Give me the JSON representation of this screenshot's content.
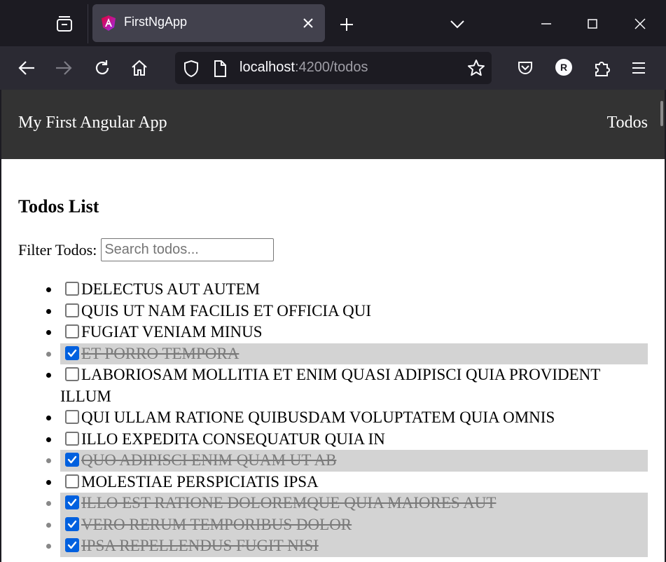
{
  "browser": {
    "tab_title": "FirstNgApp",
    "url_host": "localhost",
    "url_path": ":4200/todos",
    "profile_initial": "R"
  },
  "app": {
    "title": "My First Angular App",
    "nav_link": "Todos"
  },
  "todos": {
    "heading": "Todos List",
    "filter_label": "Filter Todos:",
    "filter_placeholder": "Search todos...",
    "filter_value": "",
    "items": [
      {
        "text": "DELECTUS AUT AUTEM",
        "completed": false
      },
      {
        "text": "QUIS UT NAM FACILIS ET OFFICIA QUI",
        "completed": false
      },
      {
        "text": "FUGIAT VENIAM MINUS",
        "completed": false
      },
      {
        "text": "ET PORRO TEMPORA",
        "completed": true
      },
      {
        "text": "LABORIOSAM MOLLITIA ET ENIM QUASI ADIPISCI QUIA PROVIDENT ILLUM",
        "completed": false
      },
      {
        "text": "QUI ULLAM RATIONE QUIBUSDAM VOLUPTATEM QUIA OMNIS",
        "completed": false
      },
      {
        "text": "ILLO EXPEDITA CONSEQUATUR QUIA IN",
        "completed": false
      },
      {
        "text": "QUO ADIPISCI ENIM QUAM UT AB",
        "completed": true
      },
      {
        "text": "MOLESTIAE PERSPICIATIS IPSA",
        "completed": false
      },
      {
        "text": "ILLO EST RATIONE DOLOREMQUE QUIA MAIORES AUT",
        "completed": true
      },
      {
        "text": "VERO RERUM TEMPORIBUS DOLOR",
        "completed": true
      },
      {
        "text": "IPSA REPELLENDUS FUGIT NISI",
        "completed": true
      }
    ]
  },
  "colors": {
    "header_bg": "#333333",
    "completed_bg": "#d3d3d3",
    "checkbox_checked": "#0060df"
  }
}
